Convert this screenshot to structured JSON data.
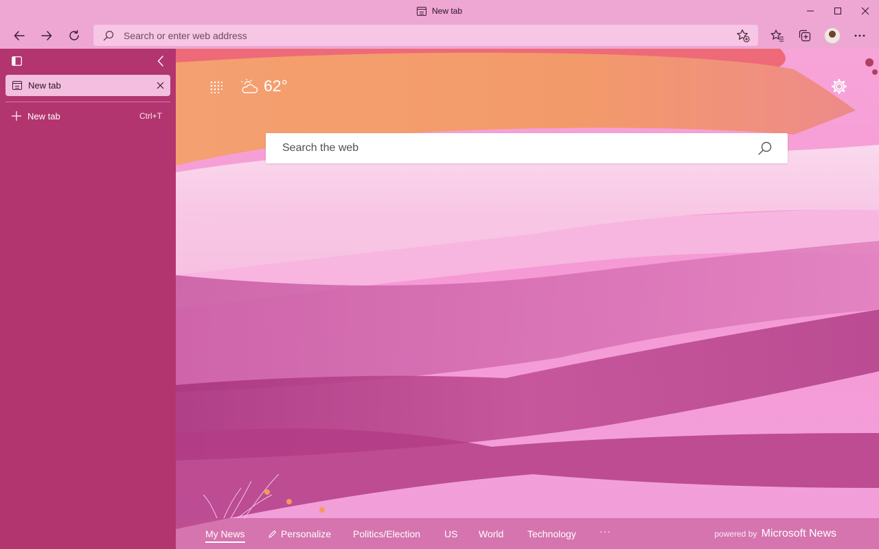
{
  "window": {
    "title": "New tab"
  },
  "toolbar": {
    "address_placeholder": "Search or enter web address"
  },
  "sidebar": {
    "tabs": [
      {
        "label": "New tab"
      }
    ],
    "new_tab": {
      "label": "New tab",
      "shortcut": "Ctrl+T"
    }
  },
  "newtab_page": {
    "weather": {
      "temperature": "62°"
    },
    "search_placeholder": "Search the web",
    "news_nav": {
      "items": [
        "My News",
        "Personalize",
        "Politics/Election",
        "US",
        "World",
        "Technology"
      ],
      "more": "···",
      "active": "My News",
      "powered_by": "powered by",
      "provider": "Microsoft News"
    }
  },
  "colors": {
    "chrome": "#eea6d3",
    "sidebar": "#b2356f",
    "active_tab": "#f3bedf",
    "background": "#f59ad5"
  },
  "icons": [
    "back-icon",
    "forward-icon",
    "refresh-icon",
    "search-icon",
    "favorite-add-icon",
    "favorites-icon",
    "collections-icon",
    "profile-avatar",
    "more-icon",
    "minimize-icon",
    "maximize-icon",
    "close-icon",
    "vertical-tabs-icon",
    "collapse-icon",
    "apps-grid-icon",
    "weather-icon",
    "settings-gear-icon",
    "plus-icon"
  ]
}
